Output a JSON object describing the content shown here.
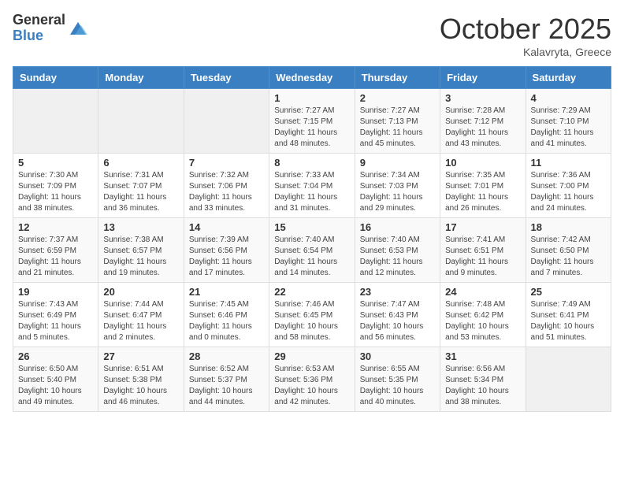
{
  "logo": {
    "general": "General",
    "blue": "Blue"
  },
  "title": "October 2025",
  "location": "Kalavryta, Greece",
  "days_of_week": [
    "Sunday",
    "Monday",
    "Tuesday",
    "Wednesday",
    "Thursday",
    "Friday",
    "Saturday"
  ],
  "weeks": [
    [
      {
        "day": "",
        "info": ""
      },
      {
        "day": "",
        "info": ""
      },
      {
        "day": "",
        "info": ""
      },
      {
        "day": "1",
        "info": "Sunrise: 7:27 AM\nSunset: 7:15 PM\nDaylight: 11 hours\nand 48 minutes."
      },
      {
        "day": "2",
        "info": "Sunrise: 7:27 AM\nSunset: 7:13 PM\nDaylight: 11 hours\nand 45 minutes."
      },
      {
        "day": "3",
        "info": "Sunrise: 7:28 AM\nSunset: 7:12 PM\nDaylight: 11 hours\nand 43 minutes."
      },
      {
        "day": "4",
        "info": "Sunrise: 7:29 AM\nSunset: 7:10 PM\nDaylight: 11 hours\nand 41 minutes."
      }
    ],
    [
      {
        "day": "5",
        "info": "Sunrise: 7:30 AM\nSunset: 7:09 PM\nDaylight: 11 hours\nand 38 minutes."
      },
      {
        "day": "6",
        "info": "Sunrise: 7:31 AM\nSunset: 7:07 PM\nDaylight: 11 hours\nand 36 minutes."
      },
      {
        "day": "7",
        "info": "Sunrise: 7:32 AM\nSunset: 7:06 PM\nDaylight: 11 hours\nand 33 minutes."
      },
      {
        "day": "8",
        "info": "Sunrise: 7:33 AM\nSunset: 7:04 PM\nDaylight: 11 hours\nand 31 minutes."
      },
      {
        "day": "9",
        "info": "Sunrise: 7:34 AM\nSunset: 7:03 PM\nDaylight: 11 hours\nand 29 minutes."
      },
      {
        "day": "10",
        "info": "Sunrise: 7:35 AM\nSunset: 7:01 PM\nDaylight: 11 hours\nand 26 minutes."
      },
      {
        "day": "11",
        "info": "Sunrise: 7:36 AM\nSunset: 7:00 PM\nDaylight: 11 hours\nand 24 minutes."
      }
    ],
    [
      {
        "day": "12",
        "info": "Sunrise: 7:37 AM\nSunset: 6:59 PM\nDaylight: 11 hours\nand 21 minutes."
      },
      {
        "day": "13",
        "info": "Sunrise: 7:38 AM\nSunset: 6:57 PM\nDaylight: 11 hours\nand 19 minutes."
      },
      {
        "day": "14",
        "info": "Sunrise: 7:39 AM\nSunset: 6:56 PM\nDaylight: 11 hours\nand 17 minutes."
      },
      {
        "day": "15",
        "info": "Sunrise: 7:40 AM\nSunset: 6:54 PM\nDaylight: 11 hours\nand 14 minutes."
      },
      {
        "day": "16",
        "info": "Sunrise: 7:40 AM\nSunset: 6:53 PM\nDaylight: 11 hours\nand 12 minutes."
      },
      {
        "day": "17",
        "info": "Sunrise: 7:41 AM\nSunset: 6:51 PM\nDaylight: 11 hours\nand 9 minutes."
      },
      {
        "day": "18",
        "info": "Sunrise: 7:42 AM\nSunset: 6:50 PM\nDaylight: 11 hours\nand 7 minutes."
      }
    ],
    [
      {
        "day": "19",
        "info": "Sunrise: 7:43 AM\nSunset: 6:49 PM\nDaylight: 11 hours\nand 5 minutes."
      },
      {
        "day": "20",
        "info": "Sunrise: 7:44 AM\nSunset: 6:47 PM\nDaylight: 11 hours\nand 2 minutes."
      },
      {
        "day": "21",
        "info": "Sunrise: 7:45 AM\nSunset: 6:46 PM\nDaylight: 11 hours\nand 0 minutes."
      },
      {
        "day": "22",
        "info": "Sunrise: 7:46 AM\nSunset: 6:45 PM\nDaylight: 10 hours\nand 58 minutes."
      },
      {
        "day": "23",
        "info": "Sunrise: 7:47 AM\nSunset: 6:43 PM\nDaylight: 10 hours\nand 56 minutes."
      },
      {
        "day": "24",
        "info": "Sunrise: 7:48 AM\nSunset: 6:42 PM\nDaylight: 10 hours\nand 53 minutes."
      },
      {
        "day": "25",
        "info": "Sunrise: 7:49 AM\nSunset: 6:41 PM\nDaylight: 10 hours\nand 51 minutes."
      }
    ],
    [
      {
        "day": "26",
        "info": "Sunrise: 6:50 AM\nSunset: 5:40 PM\nDaylight: 10 hours\nand 49 minutes."
      },
      {
        "day": "27",
        "info": "Sunrise: 6:51 AM\nSunset: 5:38 PM\nDaylight: 10 hours\nand 46 minutes."
      },
      {
        "day": "28",
        "info": "Sunrise: 6:52 AM\nSunset: 5:37 PM\nDaylight: 10 hours\nand 44 minutes."
      },
      {
        "day": "29",
        "info": "Sunrise: 6:53 AM\nSunset: 5:36 PM\nDaylight: 10 hours\nand 42 minutes."
      },
      {
        "day": "30",
        "info": "Sunrise: 6:55 AM\nSunset: 5:35 PM\nDaylight: 10 hours\nand 40 minutes."
      },
      {
        "day": "31",
        "info": "Sunrise: 6:56 AM\nSunset: 5:34 PM\nDaylight: 10 hours\nand 38 minutes."
      },
      {
        "day": "",
        "info": ""
      }
    ]
  ]
}
